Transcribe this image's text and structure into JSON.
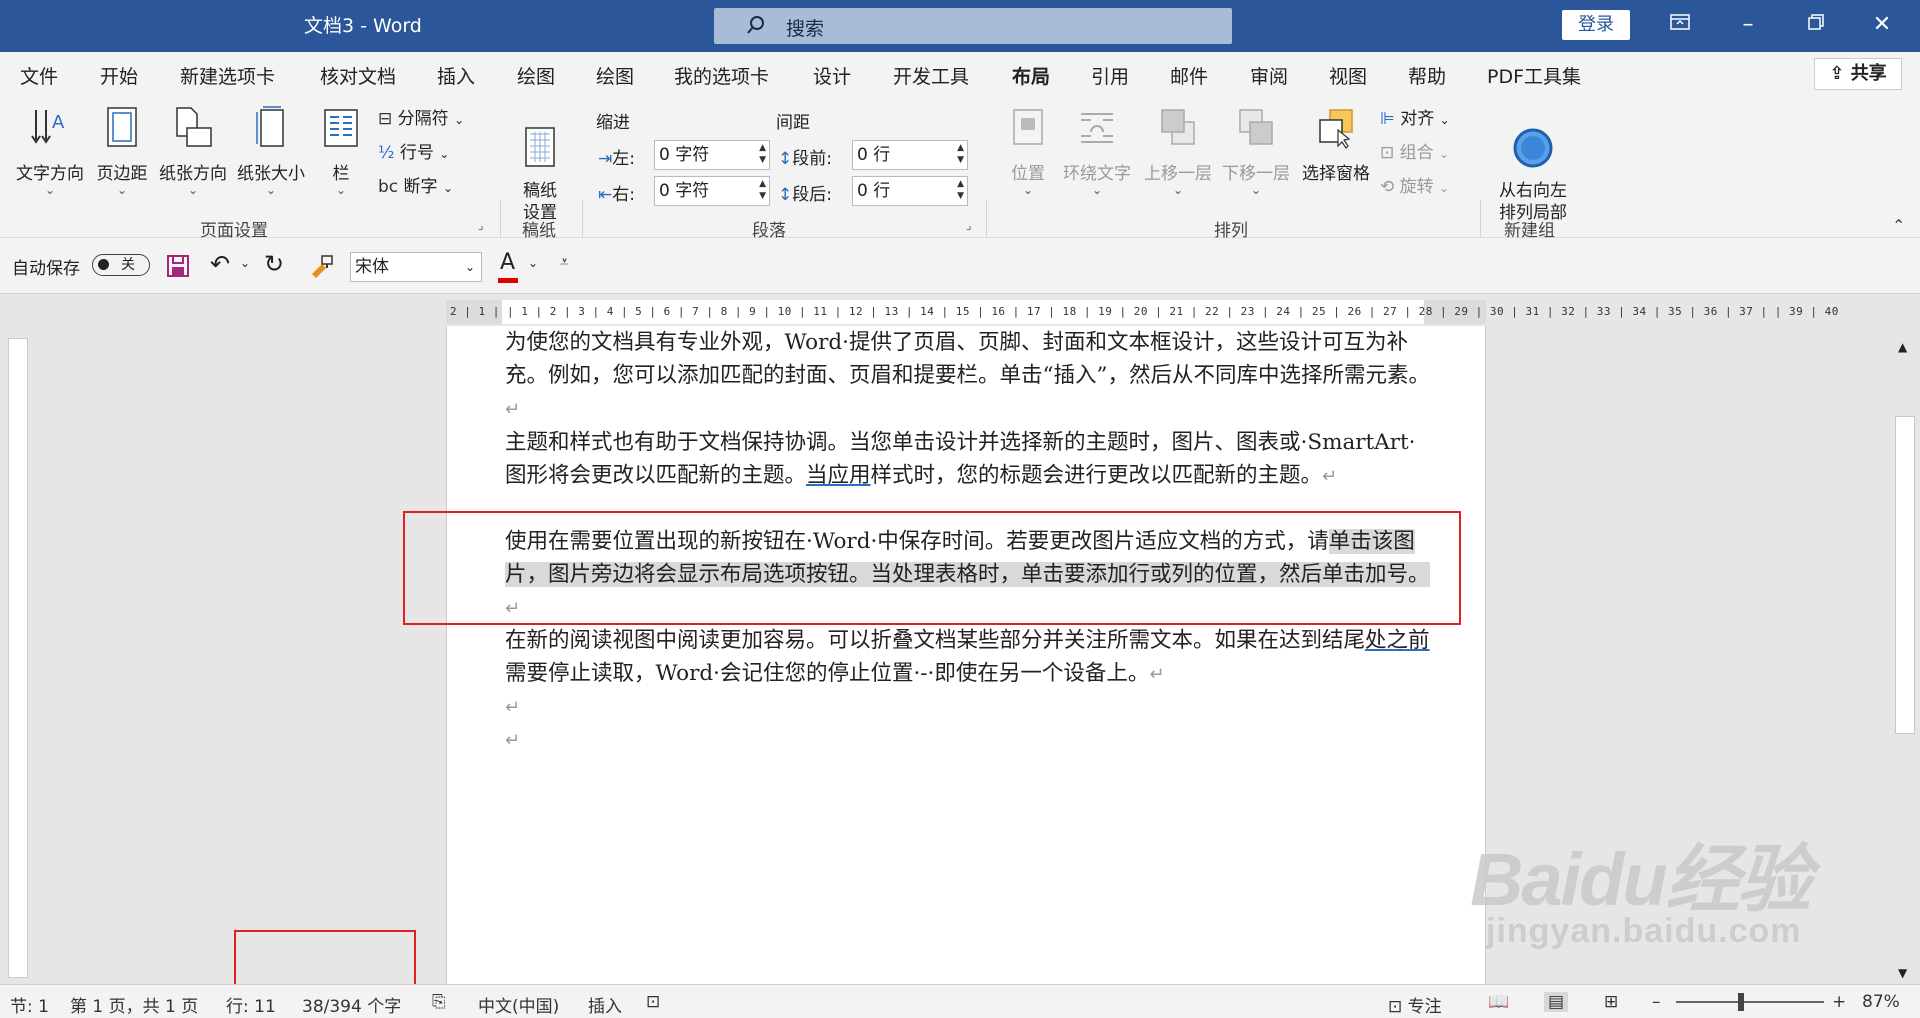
{
  "titlebar": {
    "title": "文档3  -  Word",
    "search_placeholder": "搜索",
    "login_label": "登录"
  },
  "tabs": [
    "文件",
    "开始",
    "新建选项卡",
    "核对文档",
    "插入",
    "绘图",
    "绘图",
    "我的选项卡",
    "设计",
    "开发工具",
    "布局",
    "引用",
    "邮件",
    "审阅",
    "视图",
    "帮助",
    "PDF工具集"
  ],
  "active_tab": "布局",
  "share_label": "共享",
  "ribbon": {
    "page_setup": {
      "text_direction": "文字方向",
      "margins": "页边距",
      "orientation": "纸张方向",
      "size": "纸张大小",
      "columns": "栏",
      "breaks": "分隔符",
      "line_numbers": "行号",
      "hyphenation": "断字",
      "group_label": "页面设置"
    },
    "manuscript": {
      "button": "稿纸\n设置",
      "group_label": "稿纸"
    },
    "paragraph": {
      "indent_label": "缩进",
      "spacing_label": "间距",
      "left_label": "左:",
      "left_value": "0 字符",
      "right_label": "右:",
      "right_value": "0 字符",
      "before_label": "段前:",
      "before_value": "0 行",
      "after_label": "段后:",
      "after_value": "0 行",
      "group_label": "段落"
    },
    "arrange": {
      "position": "位置",
      "wrap_text": "环绕文字",
      "bring_forward": "上移一层",
      "send_backward": "下移一层",
      "selection_pane": "选择窗格",
      "align": "对齐",
      "group": "组合",
      "rotate": "旋转",
      "group_label": "排列"
    },
    "new_group": {
      "button": "从右向左\n排列局部",
      "group_label": "新建组"
    }
  },
  "qat": {
    "autosave_label": "自动保存",
    "autosave_state": "关",
    "font_name": "宋体"
  },
  "ruler": {
    "numbers": "2 | 1 |    | 1 | 2 | 3 | 4 | 5 | 6 | 7 | 8 | 9 | 10 | 11 | 12 | 13 | 14 | 15 | 16 | 17 | 18 | 19 | 20 | 21 | 22 | 23 | 24 | 25 | 26 | 27 | 28 | 29 | 30 | 31 | 32 | 33 | 34 | 35 | 36 | 37 |    | 39 | 40"
  },
  "document": {
    "p1": "为使您的文档具有专业外观，Word·提供了页眉、页脚、封面和文本框设计，这些设计可互为补充。例如，您可以添加匹配的封面、页眉和提要栏。单击“插入”，然后从不同库中选择所需元素。",
    "p2a": "主题和样式也有助于文档保持协调。当您单击设计并选择新的主题时，图片、图表或·SmartArt·图形将会更改以匹配新的主题。",
    "p2b": "当应用",
    "p2c": "样式时，您的标题会进行更改以匹配新的主题。",
    "p3a": "使用在需要位置出现的新按钮在·Word·中保存时间。若要更改图片适应文档的方式，请",
    "p3b": "单击该图片，图片旁边将会显示布局选项按钮。当处理表格时，单击要添加行或列的位置，然后单击加号。",
    "p4a": "在新的阅读视图中阅读更加容易。可以折叠文档某些部分并关注所需文本。如果在达到结尾",
    "p4b": "处之前",
    "p4c": "需要停止读取，Word·会记住您的停止位置·-·即使在另一个设备上。",
    "mark": "↵"
  },
  "status": {
    "section": "节: 1",
    "page": "第 1 页，共 1 页",
    "line": "行: 11",
    "words": "38/394 个字",
    "language": "中文(中国)",
    "mode": "插入",
    "focus": "专注",
    "zoom": "87%"
  },
  "watermark": {
    "brand": "Baidu经验",
    "url": "jingyan.baidu.com"
  },
  "colors": {
    "title_bar": "#2b579a",
    "highlight_box": "#e02020"
  }
}
